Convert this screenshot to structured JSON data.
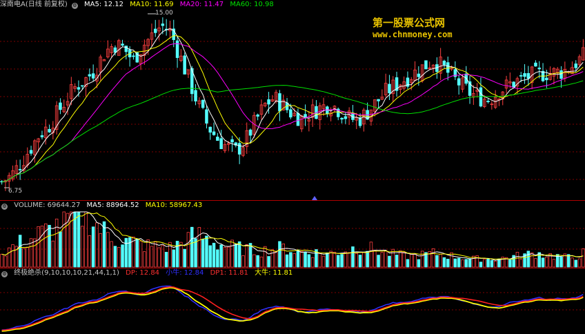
{
  "main_header": {
    "symbol": "深南电A(日线 前复权)",
    "ma5_label": "MA5: 12.12",
    "ma10_label": "MA10: 11.69",
    "ma20_label": "MA20: 11.47",
    "ma60_label": "MA60: 10.98"
  },
  "watermark": {
    "line1": "第一股票公式网",
    "line2": "www.chnmoney.com"
  },
  "price_labels": {
    "high": "15.00",
    "low": "6.75"
  },
  "volume_header": {
    "volume_label": "VOLUME: 69644.27",
    "ma5_label": "MA5: 88964.52",
    "ma10_label": "MA10: 58967.43"
  },
  "indicator_header": {
    "name": "终极绝杀(9,10,10,10,21,44,1,1)",
    "dp_label": "DP: 12.84",
    "xiaoniu_label": "小牛: 12.84",
    "dp1_label": "DP1: 11.81",
    "daniu_label": "大牛: 11.81"
  },
  "colors": {
    "background": "#000000",
    "up_candle": "#ff4040",
    "down_candle": "#54ffff",
    "ma5": "#ffffff",
    "ma10": "#ffff00",
    "ma20": "#ff00ff",
    "ma60": "#00e000",
    "grid": "#800000",
    "watermark": "#e8c200"
  },
  "chart_data": {
    "type": "candlestick",
    "price_range": [
      6.75,
      15.0
    ],
    "close_path": [
      6.9,
      7.2,
      7.8,
      8.5,
      9.2,
      9.6,
      10.3,
      11.0,
      11.6,
      11.9,
      12.4,
      13.2,
      13.6,
      13.4,
      12.8,
      13.5,
      14.0,
      14.5,
      14.2,
      13.0,
      11.8,
      10.6,
      9.6,
      9.0,
      8.6,
      8.4,
      8.9,
      9.8,
      10.6,
      11.0,
      10.6,
      10.2,
      10.0,
      10.3,
      10.5,
      10.7,
      10.4,
      10.0,
      9.9,
      10.3,
      10.8,
      11.3,
      11.6,
      11.9,
      12.2,
      12.5,
      12.8,
      12.5,
      12.0,
      11.6,
      11.2,
      11.0,
      10.9,
      11.3,
      11.6,
      11.8,
      12.0,
      12.1,
      12.2,
      12.2,
      12.3,
      12.6,
      13.0
    ],
    "volume_path": [
      20,
      28,
      35,
      40,
      48,
      52,
      60,
      70,
      78,
      80,
      62,
      50,
      42,
      38,
      36,
      32,
      30,
      30,
      28,
      34,
      42,
      46,
      40,
      34,
      30,
      28,
      26,
      24,
      24,
      26,
      28,
      24,
      22,
      22,
      20,
      20,
      22,
      26,
      28,
      28,
      24,
      20,
      18,
      16,
      16,
      18,
      20,
      18,
      16,
      14,
      12,
      12,
      12,
      12,
      14,
      16,
      18,
      20,
      18,
      16,
      14,
      14,
      20
    ]
  }
}
